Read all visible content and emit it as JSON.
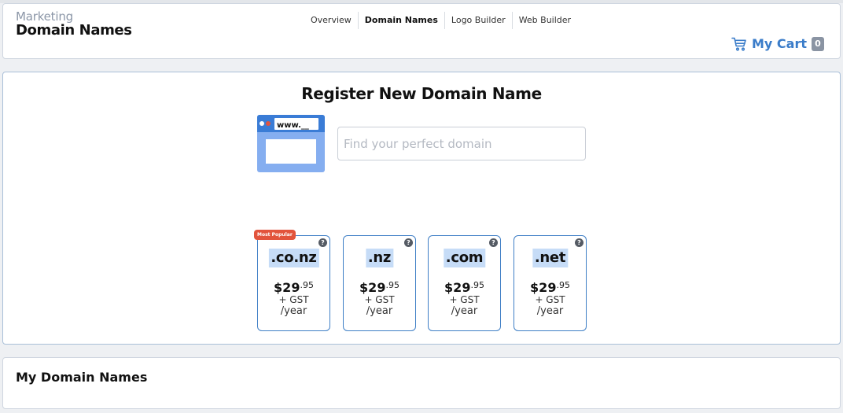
{
  "header": {
    "subtitle": "Marketing",
    "title": "Domain Names",
    "nav": [
      {
        "label": "Overview",
        "active": false
      },
      {
        "label": "Domain Names",
        "active": true
      },
      {
        "label": "Logo Builder",
        "active": false
      },
      {
        "label": "Web Builder",
        "active": false
      }
    ],
    "cart": {
      "label": "My Cart",
      "count": "0",
      "icon": "cart-icon"
    }
  },
  "register": {
    "title": "Register New Domain Name",
    "illustration_text": "www.__",
    "search": {
      "value": "",
      "placeholder": "Find your perfect domain"
    },
    "tlds": [
      {
        "name": ".co.nz",
        "price_main": "$29",
        "price_cents": ".95",
        "gst": "+ GST",
        "period": "/year",
        "badge": "Most Popular"
      },
      {
        "name": ".nz",
        "price_main": "$29",
        "price_cents": ".95",
        "gst": "+ GST",
        "period": "/year",
        "badge": ""
      },
      {
        "name": ".com",
        "price_main": "$29",
        "price_cents": ".95",
        "gst": "+ GST",
        "period": "/year",
        "badge": ""
      },
      {
        "name": ".net",
        "price_main": "$29",
        "price_cents": ".95",
        "gst": "+ GST",
        "period": "/year",
        "badge": ""
      }
    ],
    "help_icon_glyph": "?"
  },
  "my_domains": {
    "title": "My Domain Names"
  },
  "colors": {
    "accent": "#3a7cc9",
    "card_border": "#3f7fc6",
    "tld_highlight": "#c6dcf7",
    "badge": "#e2543c",
    "cart_count_bg": "#8a94a3"
  }
}
